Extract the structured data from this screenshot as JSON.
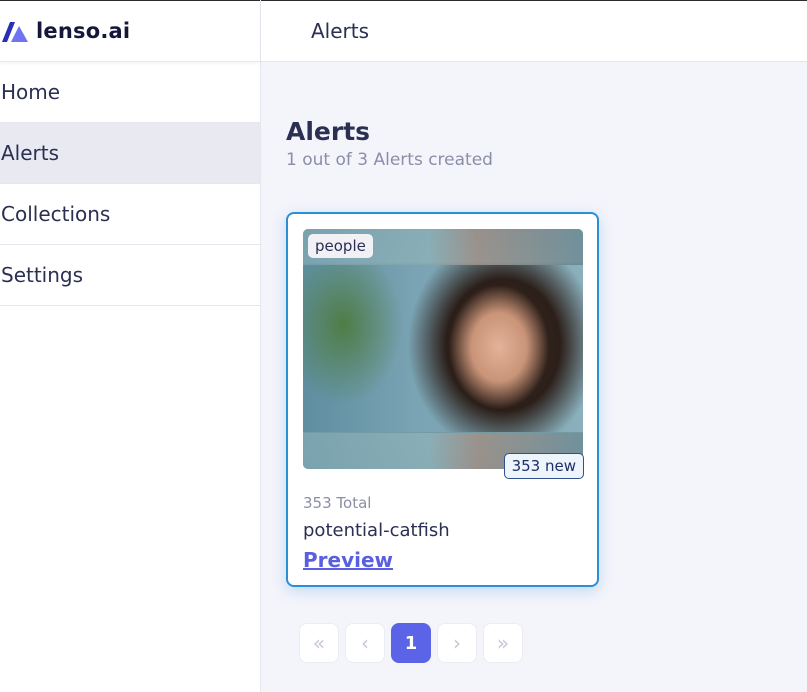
{
  "brand": {
    "name": "lenso.ai",
    "logo_icon": "lenso-logo-icon"
  },
  "sidebar": {
    "items": [
      {
        "label": "Home",
        "active": false
      },
      {
        "label": "Alerts",
        "active": true
      },
      {
        "label": "Collections",
        "active": false
      },
      {
        "label": "Settings",
        "active": false
      }
    ]
  },
  "header": {
    "title": "Alerts"
  },
  "main": {
    "title": "Alerts",
    "subtitle": "1 out of 3 Alerts created",
    "alerts": [
      {
        "tag": "people",
        "new_badge": "353 new",
        "total": "353 Total",
        "name": "potential-catfish",
        "preview_label": "Preview"
      }
    ],
    "pagination": {
      "first_icon": "double-chevron-left-icon",
      "prev_icon": "chevron-left-icon",
      "current_page": "1",
      "next_icon": "chevron-right-icon",
      "last_icon": "double-chevron-right-icon",
      "glyphs": {
        "first": "«",
        "prev": "‹",
        "next": "›",
        "last": "»"
      }
    }
  },
  "colors": {
    "accent": "#5b63e6",
    "card_border": "#2c8fd6",
    "background": "#f4f4fb",
    "text": "#2b2f52",
    "muted": "#8b8ea8"
  }
}
